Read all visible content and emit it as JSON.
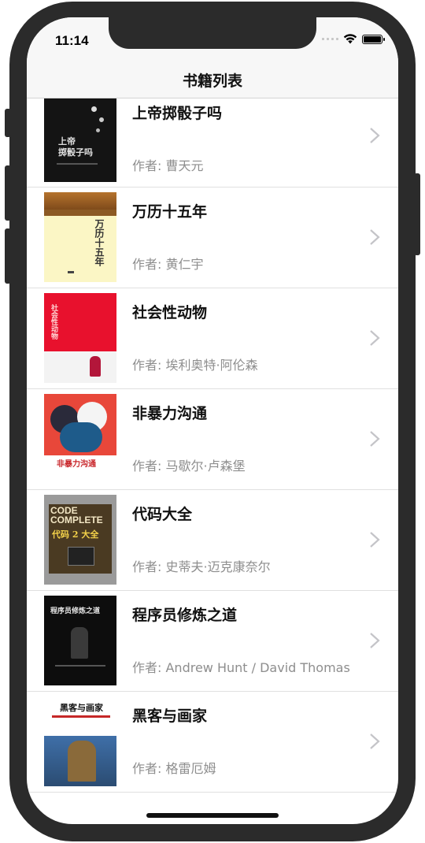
{
  "status_bar": {
    "time": "11:14"
  },
  "nav": {
    "title": "书籍列表"
  },
  "books": [
    {
      "title": "上帝掷骰子吗",
      "author": "作者: 曹天元",
      "cover_text": "上帝\n掷骰子吗",
      "cover_color": "#141414"
    },
    {
      "title": "万历十五年",
      "author": "作者: 黄仁宇",
      "cover_text": "万历十五年",
      "cover_color": "#fbf6c5"
    },
    {
      "title": "社会性动物",
      "author": "作者: 埃利奥特·阿伦森",
      "cover_text": "社会性动物",
      "cover_color": "#e8112d"
    },
    {
      "title": "非暴力沟通",
      "author": "作者: 马歇尔·卢森堡",
      "cover_text": "非暴力沟通",
      "cover_color": "#e8473a"
    },
    {
      "title": "代码大全",
      "author": "作者: 史蒂夫·迈克康奈尔",
      "cover_text_en": "CODE COMPLETE",
      "cover_text": "代码 2 大全",
      "cover_color": "#4a3a22"
    },
    {
      "title": "程序员修炼之道",
      "author": "作者: Andrew Hunt / David Thomas",
      "cover_text": "程序员修炼之道",
      "cover_color": "#0d0d0d"
    },
    {
      "title": "黑客与画家",
      "author": "作者: 格雷厄姆",
      "cover_text": "黑客与画家",
      "cover_color": "#ffffff"
    }
  ]
}
